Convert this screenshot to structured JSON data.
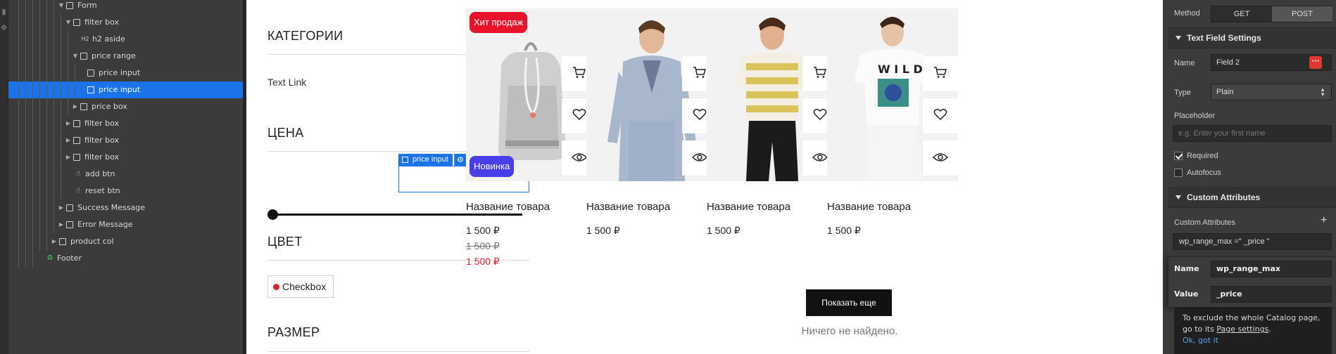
{
  "navigator": {
    "rows": [
      {
        "label": "Form",
        "indent": 0,
        "toggle": "open",
        "icon": "box"
      },
      {
        "label": "filter box",
        "indent": 1,
        "toggle": "open",
        "icon": "box"
      },
      {
        "label": "h2 aside",
        "indent": 2,
        "toggle": "",
        "icon": "h2"
      },
      {
        "label": "price range",
        "indent": 2,
        "toggle": "open",
        "icon": "box"
      },
      {
        "label": "price input",
        "indent": 3,
        "toggle": "",
        "icon": "box"
      },
      {
        "label": "price input",
        "indent": 3,
        "toggle": "",
        "icon": "box",
        "selected": true
      },
      {
        "label": "price box",
        "indent": 2,
        "toggle": "closed",
        "icon": "box"
      },
      {
        "label": "filter box",
        "indent": 1,
        "toggle": "closed",
        "icon": "box"
      },
      {
        "label": "filter box",
        "indent": 1,
        "toggle": "closed",
        "icon": "box"
      },
      {
        "label": "filter box",
        "indent": 1,
        "toggle": "closed",
        "icon": "box"
      },
      {
        "label": "add btn",
        "indent": 1,
        "toggle": "",
        "icon": "hand"
      },
      {
        "label": "reset btn",
        "indent": 1,
        "toggle": "",
        "icon": "hand"
      },
      {
        "label": "Success Message",
        "indent": 0,
        "toggle": "closed",
        "icon": "box"
      },
      {
        "label": "Error Message",
        "indent": 0,
        "toggle": "closed",
        "icon": "box"
      },
      {
        "label": "product col",
        "indent": -1,
        "toggle": "closed",
        "icon": "box"
      },
      {
        "label": "Footer",
        "indent": -3,
        "toggle": "",
        "icon": "symbol"
      }
    ]
  },
  "sidebar": {
    "categories_title": "КАТЕГОРИИ",
    "text_link": "Text Link",
    "price_title": "ЦЕНА",
    "price_input_tag": "price input",
    "color_title": "ЦВЕТ",
    "checkbox_label": "Checkbox",
    "size_title": "РАЗМЕР"
  },
  "products": [
    {
      "name": "Название товара",
      "prices": [
        "1 500 ₽",
        "1 500 ₽",
        "1 500 ₽"
      ],
      "badges": [
        "Хит продаж",
        "Новинка"
      ],
      "image": "backpack"
    },
    {
      "name": "Название товара",
      "prices": [
        "1 500 ₽"
      ],
      "badges": [],
      "image": "man-suit"
    },
    {
      "name": "Название товара",
      "prices": [
        "1 500 ₽"
      ],
      "badges": [],
      "image": "man-striped-tee"
    },
    {
      "name": "Название товара",
      "prices": [
        "1 500 ₽"
      ],
      "badges": [],
      "image": "man-white-tee"
    }
  ],
  "show_more_label": "Показать еще",
  "nothing_found": "Ничего не найдено.",
  "panel": {
    "method_label": "Method",
    "method_options": [
      "GET",
      "POST"
    ],
    "method_selected": "POST",
    "text_field_header": "Text Field Settings",
    "name_label": "Name",
    "name_value": "Field 2",
    "type_label": "Type",
    "type_value": "Plain",
    "placeholder_label": "Placeholder",
    "placeholder_hint": "e.g. Enter your first name",
    "required_label": "Required",
    "required_checked": true,
    "autofocus_label": "Autofocus",
    "autofocus_checked": false,
    "custom_header": "Custom Attributes",
    "custom_label": "Custom Attributes",
    "attr_row": "wp_range_max =\" _price \"",
    "attr_name_label": "Name",
    "attr_name_value": "wp_range_max",
    "attr_value_label": "Value",
    "attr_value_value": "_price",
    "tooltip_line1": "To exclude the whole Catalog page,",
    "tooltip_line2_pre": "go to its ",
    "tooltip_link": "Page settings",
    "tooltip_line2_post": ".",
    "tooltip_ok": "Ok, got it"
  },
  "colors": {
    "selection": "#1a73e8",
    "hit_badge": "#e8132a",
    "new_badge": "#4a3ee8",
    "sale_price": "#e0202a"
  }
}
